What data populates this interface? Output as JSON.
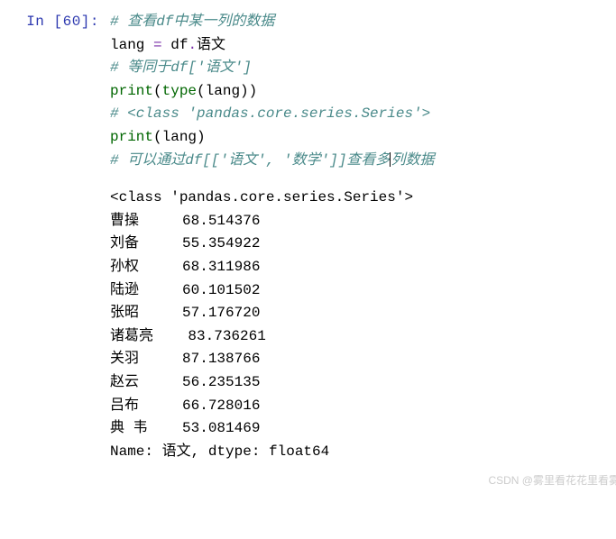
{
  "prompt": {
    "label": "In  [60]:"
  },
  "code": {
    "line1": "# 查看df中某一列的数据",
    "line2_var": "lang ",
    "line2_op": "=",
    "line2_rhs": " df",
    "line2_op2": ".",
    "line2_attr": "语文",
    "line3": "# 等同于df['语文']",
    "line4_print": "print",
    "line4_lp": "(",
    "line4_type": "type",
    "line4_lp2": "(",
    "line4_arg": "lang",
    "line4_rp": "))",
    "line5": "# <class 'pandas.core.series.Series'>",
    "line6_print": "print",
    "line6_lp": "(",
    "line6_arg": "lang",
    "line6_rp": ")",
    "line7a": "# 可以通过df[['语文', '数学']]查看多",
    "line7b": "列数据"
  },
  "output": {
    "line1": "<class 'pandas.core.series.Series'>",
    "line2": "曹操     68.514376",
    "line3": "刘备     55.354922",
    "line4": "孙权     68.311986",
    "line5": "陆逊     60.101502",
    "line6": "张昭     57.176720",
    "line7": "诸葛亮    83.736261",
    "line8": "关羽     87.138766",
    "line9": "赵云     56.235135",
    "line10": "吕布     66.728016",
    "line11": "典 韦    53.081469",
    "line12": "Name: 语文, dtype: float64"
  },
  "watermark": "CSDN @雾里看花花里看雾",
  "chart_data": {
    "type": "table",
    "title": "语文",
    "dtype": "float64",
    "rows": [
      {
        "name": "曹操",
        "value": 68.514376
      },
      {
        "name": "刘备",
        "value": 55.354922
      },
      {
        "name": "孙权",
        "value": 68.311986
      },
      {
        "name": "陆逊",
        "value": 60.101502
      },
      {
        "name": "张昭",
        "value": 57.17672
      },
      {
        "name": "诸葛亮",
        "value": 83.736261
      },
      {
        "name": "关羽",
        "value": 87.138766
      },
      {
        "name": "赵云",
        "value": 56.235135
      },
      {
        "name": "吕布",
        "value": 66.728016
      },
      {
        "name": "典 韦",
        "value": 53.081469
      }
    ]
  }
}
